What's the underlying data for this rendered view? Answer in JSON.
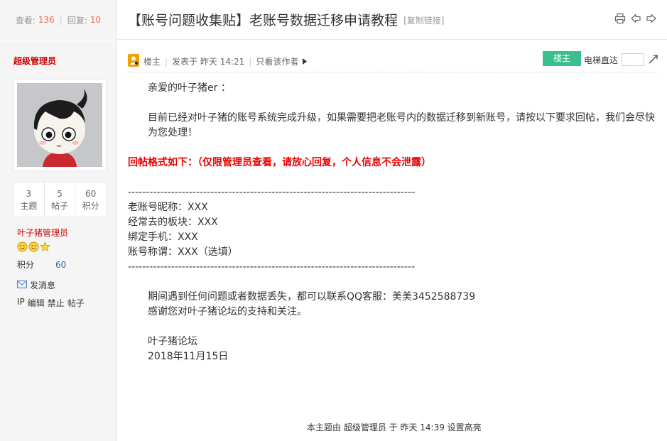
{
  "header": {
    "views_label": "查看:",
    "views_count": "136",
    "replies_label": "回复:",
    "replies_count": "10",
    "title": "【账号问题收集贴】老账号数据迁移申请教程",
    "copy_link": "[复制链接]",
    "icons": [
      "print-icon",
      "prev-thread-icon",
      "next-thread-icon"
    ]
  },
  "author": {
    "name": "超级管理员",
    "stats": [
      {
        "value": "3",
        "label": "主题"
      },
      {
        "value": "5",
        "label": "帖子"
      },
      {
        "value": "60",
        "label": "积分"
      }
    ],
    "group": "叶子猪管理员",
    "points_label": "积分",
    "points_value": "60",
    "send_message": "发消息",
    "admin_links": [
      "IP",
      "编辑",
      "禁止",
      "帖子"
    ]
  },
  "post": {
    "floor": "楼主",
    "sep": "|",
    "posted_at": "发表于 昨天 14:21",
    "only_author": "只看该作者",
    "floor_badge": "楼主",
    "jump_label": "电梯直达",
    "greeting": "亲爱的叶子猪er ：",
    "intro": "目前已经对叶子猪的账号系统完成升级，如果需要把老账号内的数据迁移到新账号，请按以下要求回帖，我们会尽快为您处理！",
    "format_title": "回帖格式如下：（仅限管理员查看，请放心回复，个人信息不会泄露）",
    "divider": "--------------------------------------------------------------------------------",
    "fields": [
      "老账号昵称：XXX",
      "经常去的板块：XXX",
      "绑定手机：XXX",
      "账号称谓：XXX（选填）"
    ],
    "contact": "期间遇到任何问题或者数据丢失，都可以联系QQ客服：美美3452588739",
    "thanks": "感谢您对叶子猪论坛的支持和关注。",
    "signature": "叶子猪论坛",
    "date": "2018年11月15日"
  },
  "footer": {
    "note": "本主题由 超级管理员 于 昨天 14:39 设置高亮"
  },
  "colors": {
    "accent_red": "#cc0000",
    "count_orange": "#f26c4f",
    "badge_green": "#3cbf8f"
  }
}
